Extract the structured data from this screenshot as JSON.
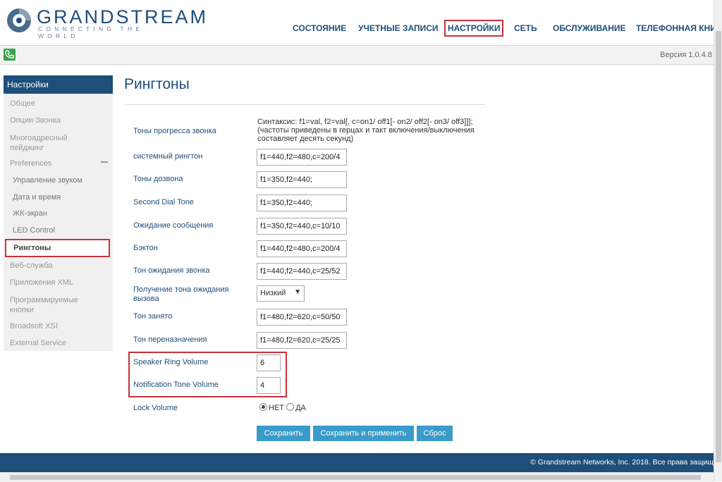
{
  "header": {
    "brand_name": "GRANDSTREAM",
    "brand_slogan": "CONNECTING THE WORLD",
    "nav": [
      {
        "label": "СОСТОЯНИЕ"
      },
      {
        "label": "УЧЕТНЫЕ ЗАПИСИ"
      },
      {
        "label": "НАСТРОЙКИ",
        "active": true
      },
      {
        "label": "СЕТЬ"
      },
      {
        "label": "ОБСЛУЖИВАНИЕ"
      },
      {
        "label": "ТЕЛЕФОННАЯ КНИ"
      }
    ]
  },
  "subbar": {
    "icon": "phone-icon",
    "version": "Версия 1.0.4.8"
  },
  "sidebar": {
    "header": "Настройки",
    "items": [
      {
        "label": "Общее"
      },
      {
        "label": "Опции Звонка"
      },
      {
        "label": "Многоадресный пейджинг"
      },
      {
        "label": "Preferences"
      },
      {
        "label": "Управление звуком"
      },
      {
        "label": "Дата и время"
      },
      {
        "label": "ЖК-экран"
      },
      {
        "label": "LED Control"
      },
      {
        "label": "Рингтоны",
        "active": true
      },
      {
        "label": "Веб-служба"
      },
      {
        "label": "Приложения XML"
      },
      {
        "label": "Программируемые кнопки"
      },
      {
        "label": "Broadsoft XSI"
      },
      {
        "label": "External Service"
      }
    ]
  },
  "main": {
    "title": "Рингтоны",
    "syntax_hint": "Синтаксис: f1=val, f2=val[, c=on1/ off1[- on2/ off2[- on3/ off3]]]; (частоты приведены в герцах и такт включения/выключения составляет десять секунд)",
    "rows": [
      {
        "label": "Тоны прогресса звонка"
      },
      {
        "label": "системный рингтон",
        "value": "f1=440,f2=480,c=200/4"
      },
      {
        "label": "Тоны дозвона",
        "value": "f1=350,f2=440;"
      },
      {
        "label": "Second Dial Tone",
        "value": "f1=350,f2=440;"
      },
      {
        "label": "Ожидание сообщения",
        "value": "f1=350,f2=440,c=10/10"
      },
      {
        "label": "Бэктон",
        "value": "f1=440,f2=480,c=200/4"
      },
      {
        "label": "Тон ожидания звонка",
        "value": "f1=440,f2=440,c=25/52"
      },
      {
        "label": "Получение тона ожидания вызова",
        "value": "Низкий"
      },
      {
        "label": "Тон занято",
        "value": "f1=480,f2=620,c=50/50"
      },
      {
        "label": "Тон переназначения",
        "value": "f1=480,f2=620,c=25/25"
      },
      {
        "label": "Speaker Ring Volume",
        "value": "6"
      },
      {
        "label": "Notification Tone Volume",
        "value": "4"
      },
      {
        "label": "Lock Volume"
      }
    ],
    "lock_volume": {
      "no": "НЕТ",
      "yes": "ДА",
      "selected": "НЕТ"
    },
    "buttons": {
      "save": "Сохранить",
      "save_apply": "Сохранить и применить",
      "reset": "Сброс"
    }
  },
  "footer": {
    "copyright": "© Grandstream Networks, Inc. 2018. Все права защищ"
  },
  "colors": {
    "brand": "#1e4e7a",
    "highlight": "#c8323c",
    "button": "#3b9bc8",
    "phone": "#37a34a"
  }
}
